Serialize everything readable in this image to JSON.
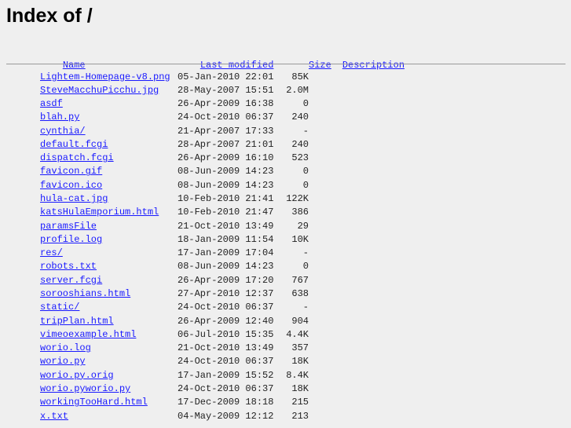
{
  "title": "Index of /",
  "headers": {
    "name": "Name",
    "modified": "Last modified",
    "size": "Size",
    "description": "Description"
  },
  "files": [
    {
      "name": "Lightem-Homepage-v8.png",
      "modified": "05-Jan-2010 22:01",
      "size": "85K"
    },
    {
      "name": "SteveMacchuPicchu.jpg",
      "modified": "28-May-2007 15:51",
      "size": "2.0M"
    },
    {
      "name": "asdf",
      "modified": "26-Apr-2009 16:38",
      "size": "0"
    },
    {
      "name": "blah.py",
      "modified": "24-Oct-2010 06:37",
      "size": "240"
    },
    {
      "name": "cynthia/",
      "modified": "21-Apr-2007 17:33",
      "size": "-"
    },
    {
      "name": "default.fcgi",
      "modified": "28-Apr-2007 21:01",
      "size": "240"
    },
    {
      "name": "dispatch.fcgi",
      "modified": "26-Apr-2009 16:10",
      "size": "523"
    },
    {
      "name": "favicon.gif",
      "modified": "08-Jun-2009 14:23",
      "size": "0"
    },
    {
      "name": "favicon.ico",
      "modified": "08-Jun-2009 14:23",
      "size": "0"
    },
    {
      "name": "hula-cat.jpg",
      "modified": "10-Feb-2010 21:41",
      "size": "122K"
    },
    {
      "name": "katsHulaEmporium.html",
      "modified": "10-Feb-2010 21:47",
      "size": "386"
    },
    {
      "name": "paramsFile",
      "modified": "21-Oct-2010 13:49",
      "size": "29"
    },
    {
      "name": "profile.log",
      "modified": "18-Jan-2009 11:54",
      "size": "10K"
    },
    {
      "name": "res/",
      "modified": "17-Jan-2009 17:04",
      "size": "-"
    },
    {
      "name": "robots.txt",
      "modified": "08-Jun-2009 14:23",
      "size": "0"
    },
    {
      "name": "server.fcgi",
      "modified": "26-Apr-2009 17:20",
      "size": "767"
    },
    {
      "name": "sorooshians.html",
      "modified": "27-Apr-2010 12:37",
      "size": "638"
    },
    {
      "name": "static/",
      "modified": "24-Oct-2010 06:37",
      "size": "-"
    },
    {
      "name": "tripPlan.html",
      "modified": "26-Apr-2009 12:40",
      "size": "904"
    },
    {
      "name": "vimeoexample.html",
      "modified": "06-Jul-2010 15:35",
      "size": "4.4K"
    },
    {
      "name": "worio.log",
      "modified": "21-Oct-2010 13:49",
      "size": "357"
    },
    {
      "name": "worio.py",
      "modified": "24-Oct-2010 06:37",
      "size": "18K"
    },
    {
      "name": "worio.py.orig",
      "modified": "17-Jan-2009 15:52",
      "size": "8.4K"
    },
    {
      "name": "worio.pyworio.py",
      "modified": "24-Oct-2010 06:37",
      "size": "18K"
    },
    {
      "name": "workingTooHard.html",
      "modified": "17-Dec-2009 18:18",
      "size": "215"
    },
    {
      "name": "x.txt",
      "modified": "04-May-2009 12:12",
      "size": "213"
    }
  ]
}
